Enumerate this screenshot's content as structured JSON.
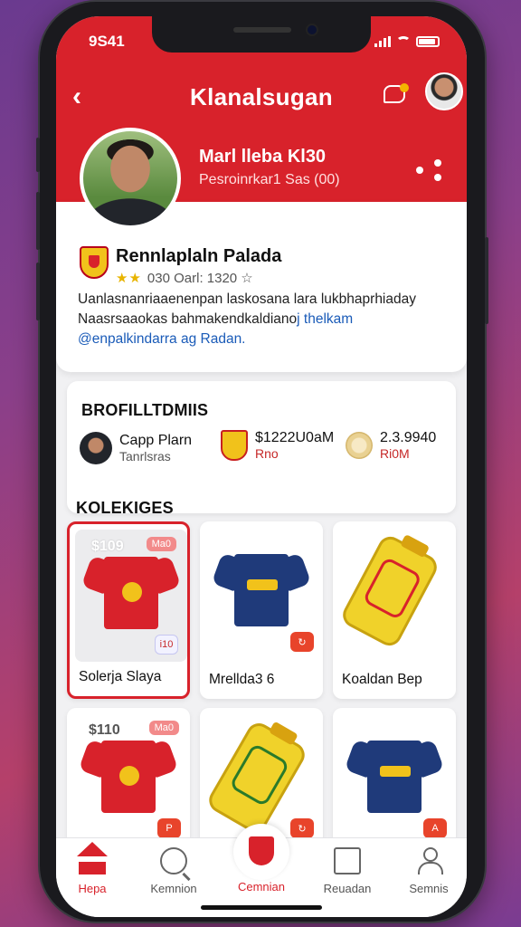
{
  "status": {
    "time": "9S41"
  },
  "header": {
    "title": "Klanalsugan"
  },
  "hero": {
    "name": "Marl lleba Kl30",
    "subtitle": "Pesroinrkar1 Sas (00)"
  },
  "club": {
    "name": "Rennlaplaln Palada",
    "rating_stars": "★★",
    "rating_text": "030  Oarl: 1320  ☆",
    "bio_line1": "Uanlasnanriaaenenpan laskosana lara lukbhaprhiaday",
    "bio_line2_prefix": "Naasrsaaokas bahmakendkaldiano",
    "bio_line2_link": "j thelkam",
    "bio_line3": "@enpalkindarra ag Radan."
  },
  "stats": {
    "title": "BROFILLTDMIIS",
    "items": [
      {
        "value": "Capp Plarn",
        "sub": "Tanrlsras"
      },
      {
        "value": "$1222U0aM",
        "sub": "Rno"
      },
      {
        "value": "2.3.9940",
        "sub": "Ri0M"
      }
    ]
  },
  "collection": {
    "title": "KOLEKIGES",
    "items": [
      {
        "price": "$109",
        "tag": "Ma0",
        "badge": "i10",
        "label": "Solerja Slaya",
        "kind": "shirt-red"
      },
      {
        "price": "",
        "tag": "",
        "badge": "↻",
        "label": "Mrellda3 6",
        "kind": "shirt-blue"
      },
      {
        "price": "",
        "tag": "",
        "badge": "",
        "label": "Koaldan Bep",
        "kind": "tube"
      },
      {
        "price": "$110",
        "tag": "Ma0",
        "badge": "P",
        "label": "",
        "kind": "shirt-red"
      },
      {
        "price": "",
        "tag": "",
        "badge": "↻",
        "label": "",
        "kind": "tube"
      },
      {
        "price": "",
        "tag": "",
        "badge": "A",
        "label": "",
        "kind": "shirt-blue"
      }
    ]
  },
  "nav": {
    "items": [
      "Hepa",
      "Kemnion",
      "Cemnian",
      "Reuadan",
      "Semnis"
    ]
  },
  "colors": {
    "accent": "#d8222b",
    "link": "#1a5bb8"
  }
}
